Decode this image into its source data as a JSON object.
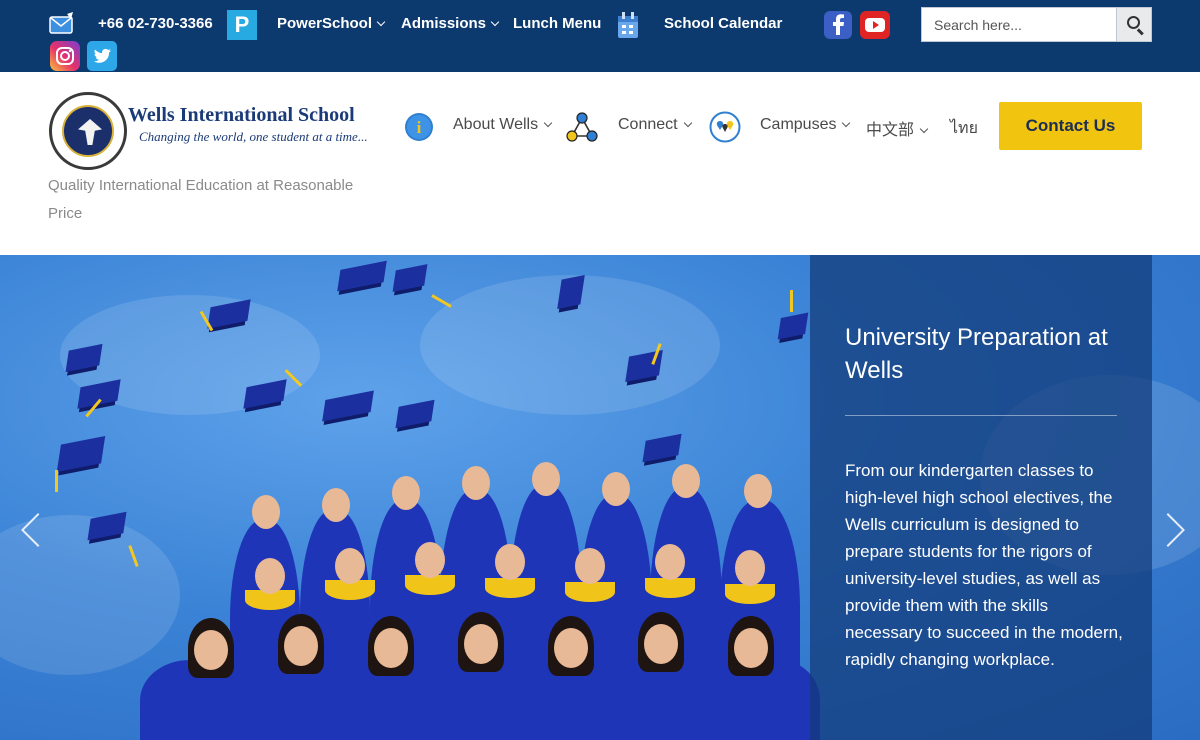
{
  "topbar": {
    "phone": "+66 02-730-3366",
    "powerschool": "PowerSchool",
    "admissions": "Admissions",
    "lunch_menu": "Lunch Menu",
    "school_calendar": "School Calendar",
    "powerschool_letter": "P",
    "search_placeholder": "Search here..."
  },
  "brand": {
    "name": "Wells International School",
    "motto": "Changing the world, one student at a time...",
    "tagline": "Quality International Education at Reasonable Price"
  },
  "nav": {
    "about": "About Wells",
    "connect": "Connect",
    "campuses": "Campuses",
    "chinese": "中文部",
    "thai": "ไทย",
    "contact": "Contact Us",
    "info_letter": "i"
  },
  "hero": {
    "title": "University Preparation at Wells",
    "body": "From our kindergarten classes to high-level high school electives, the Wells curriculum is designed to prepare students for the rigors of university-level studies, as well as provide them with the skills necessary to succeed in the modern, rapidly changing workplace."
  },
  "colors": {
    "topbar": "#0d3a6e",
    "accent": "#f1c40f",
    "brand": "#1a3a78"
  },
  "icons": [
    "email-icon",
    "powerschool-icon",
    "calendar-icon",
    "facebook-icon",
    "youtube-icon",
    "instagram-icon",
    "twitter-icon",
    "search-icon",
    "info-icon",
    "connect-icon",
    "campuses-icon",
    "chevron-left-icon",
    "chevron-right-icon"
  ]
}
